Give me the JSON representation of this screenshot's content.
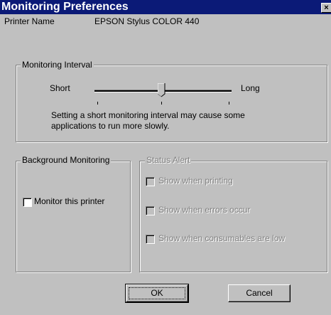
{
  "window": {
    "title": "Monitoring Preferences",
    "close_glyph": "×"
  },
  "printer": {
    "label": "Printer Name",
    "value": "EPSON Stylus COLOR 440"
  },
  "interval": {
    "group_label": "Monitoring Interval",
    "min_label": "Short",
    "max_label": "Long",
    "slider_fraction": 0.5,
    "note_line1": "Setting a short monitoring interval may cause some",
    "note_line2": "applications to run more slowly."
  },
  "background": {
    "group_label": "Background Monitoring",
    "monitor_label": "Monitor this printer",
    "monitor_checked": false
  },
  "status_alert": {
    "group_label": "Status Alert",
    "items": [
      {
        "label": "Show when printing",
        "checked": false
      },
      {
        "label": "Show when errors occur",
        "checked": false
      },
      {
        "label": "Show when consumables are low",
        "checked": false
      }
    ]
  },
  "buttons": {
    "ok": "OK",
    "cancel": "Cancel"
  }
}
